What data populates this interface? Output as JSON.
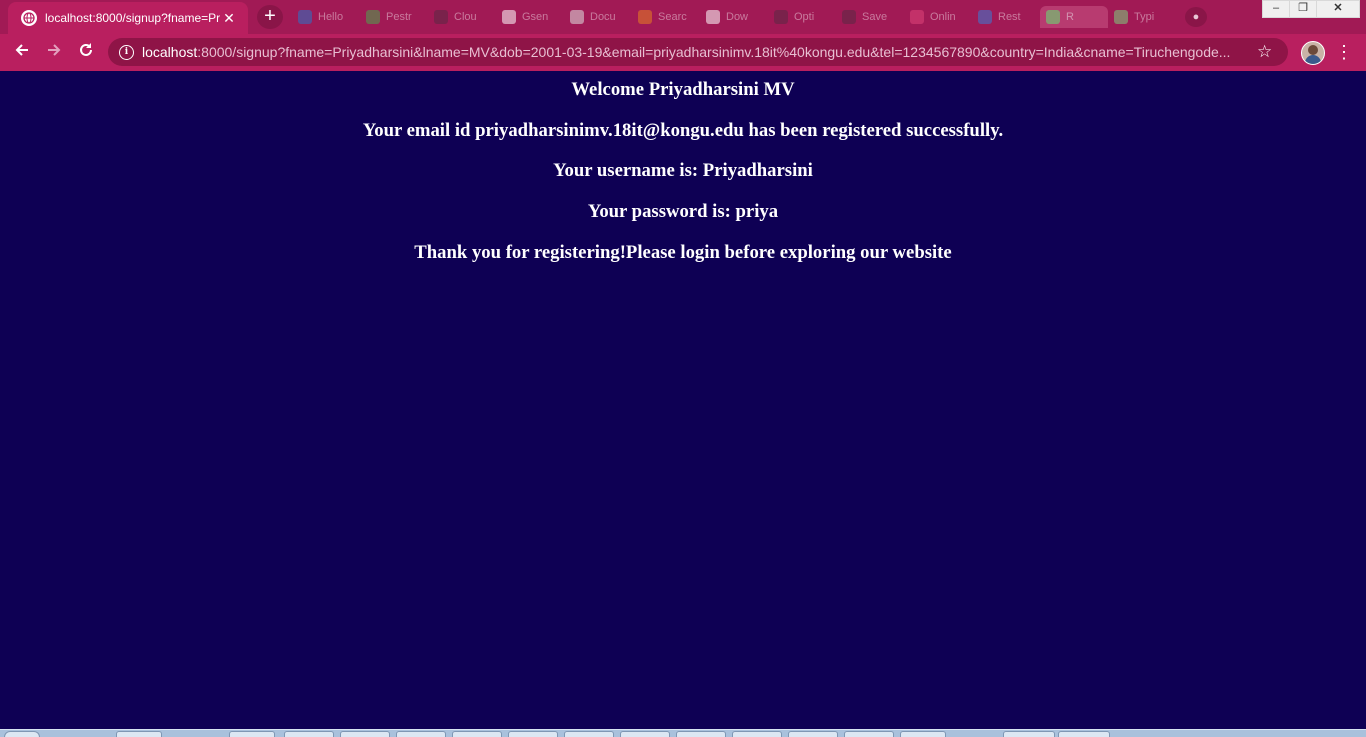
{
  "browser": {
    "active_tab": {
      "title": "localhost:8000/signup?fname=Pr",
      "favicon": "globe-icon"
    },
    "background_tabs": [
      {
        "label": "Hello",
        "color": "#2a73c9"
      },
      {
        "label": "Pestr",
        "color": "#4aa84c"
      },
      {
        "label": "Clou",
        "color": "#5a2a44"
      },
      {
        "label": "Gsen",
        "color": "#ffffff"
      },
      {
        "label": "Docu",
        "color": "#e0e0e0"
      },
      {
        "label": "Searc",
        "color": "#e67e22"
      },
      {
        "label": "Dow",
        "color": "#ffffff"
      },
      {
        "label": "Opti",
        "color": "#5a2a44"
      },
      {
        "label": "Save",
        "color": "#5a2a44"
      },
      {
        "label": "Onlin",
        "color": "#e0457b"
      },
      {
        "label": "Rest",
        "color": "#3a7bd5"
      },
      {
        "label": "R",
        "color": "#7ed07e"
      },
      {
        "label": "Typi",
        "color": "#7ed07e"
      }
    ],
    "url_host": "localhost",
    "url_rest": ":8000/signup?fname=Priyadharsini&lname=MV&dob=2001-03-19&email=priyadharsinimv.18it%40kongu.edu&tel=1234567890&country=India&cname=Tiruchengode...",
    "window_controls": {
      "minimize": "–",
      "restore": "❐",
      "close": "✕"
    },
    "icons": {
      "back": "back-arrow-icon",
      "forward": "forward-arrow-icon",
      "reload": "reload-icon",
      "info": "info-icon",
      "star": "star-icon",
      "menu": "kebab-menu-icon",
      "new_tab": "plus-icon"
    }
  },
  "page": {
    "welcome": "Welcome Priyadharsini MV",
    "email_line": "Your email id priyadharsinimv.18it@kongu.edu has been registered successfully.",
    "username_line": "Your username is: Priyadharsini",
    "password_line": "Your password is: priya",
    "thanks_line": "Thank you for registering!Please login before exploring our website"
  },
  "colors": {
    "page_background": "#0e0054",
    "page_text": "#ffffff",
    "browser_frame": "#b91f5f"
  }
}
